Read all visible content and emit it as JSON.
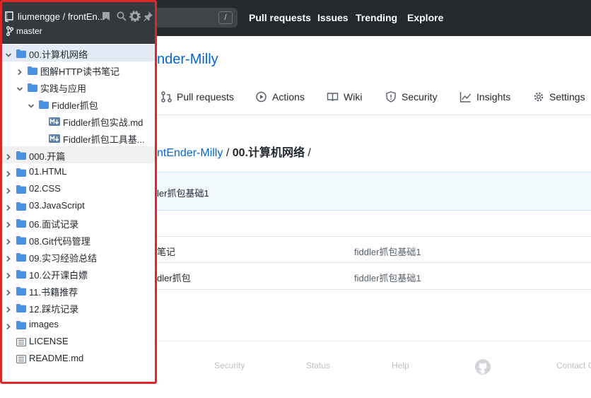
{
  "header": {
    "search_shortcut": "/",
    "nav": [
      "Pull requests",
      "Issues",
      "Trending",
      "Explore"
    ]
  },
  "repo": {
    "title_fragment": "nder-Milly",
    "tabs": [
      "Pull requests",
      "Actions",
      "Wiki",
      "Security",
      "Insights",
      "Settings"
    ]
  },
  "breadcrumb": {
    "root_fragment": "ntEnder-Milly",
    "sep1": "/",
    "current": "00.计算机网络",
    "sep2": "/"
  },
  "commit": {
    "message_fragment": "ler抓包基础1"
  },
  "files": [
    {
      "name_fragment": "笔记",
      "message": "fiddler抓包基础1"
    },
    {
      "name_fragment": "dler抓包",
      "message": "fiddler抓包基础1"
    }
  ],
  "footer": {
    "links": [
      "Security",
      "Status",
      "Help",
      "Contact G"
    ]
  },
  "sidebar": {
    "repo": "liumengge / frontEnder-Milly",
    "branch": "master",
    "tree": [
      {
        "label": "00.计算机网络",
        "type": "folder",
        "depth": 0,
        "expanded": true,
        "selected": true
      },
      {
        "label": "图解HTTP读书笔记",
        "type": "folder",
        "depth": 1,
        "expanded": false
      },
      {
        "label": "实践与应用",
        "type": "folder",
        "depth": 1,
        "expanded": true
      },
      {
        "label": "Fiddler抓包",
        "type": "folder",
        "depth": 2,
        "expanded": true
      },
      {
        "label": "Fiddler抓包实战.md",
        "type": "md",
        "depth": 3
      },
      {
        "label": "Fiddler抓包工具基础.md",
        "type": "md",
        "depth": 3
      },
      {
        "label": "000.开篇",
        "type": "folder",
        "depth": 0,
        "expanded": false,
        "hovered": true
      },
      {
        "label": "01.HTML",
        "type": "folder",
        "depth": 0,
        "expanded": false
      },
      {
        "label": "02.CSS",
        "type": "folder",
        "depth": 0,
        "expanded": false
      },
      {
        "label": "03.JavaScript",
        "type": "folder",
        "depth": 0,
        "expanded": false
      },
      {
        "label": "06.面试记录",
        "type": "folder",
        "depth": 0,
        "expanded": false
      },
      {
        "label": "08.Git代码管理",
        "type": "folder",
        "depth": 0,
        "expanded": false
      },
      {
        "label": "09.实习经验总结",
        "type": "folder",
        "depth": 0,
        "expanded": false
      },
      {
        "label": "10.公开课白嫖",
        "type": "folder",
        "depth": 0,
        "expanded": false
      },
      {
        "label": "11.书籍推荐",
        "type": "folder",
        "depth": 0,
        "expanded": false
      },
      {
        "label": "12.踩坑记录",
        "type": "folder",
        "depth": 0,
        "expanded": false
      },
      {
        "label": "images",
        "type": "folder",
        "depth": 0,
        "expanded": false
      },
      {
        "label": "LICENSE",
        "type": "file",
        "depth": 0
      },
      {
        "label": "README.md",
        "type": "file",
        "depth": 0
      }
    ]
  },
  "colors": {
    "header_bg": "#24292e",
    "link": "#0366d6",
    "folder": "#4a90e2",
    "sidebar_border": "#e22626",
    "selected_row": "#e3ecf6"
  },
  "icons": [
    "repo-icon",
    "branch-icon",
    "bookmark-icon",
    "search-icon",
    "gear-icon",
    "pin-icon",
    "folder-icon",
    "markdown-icon",
    "file-icon",
    "github-logo-icon"
  ]
}
